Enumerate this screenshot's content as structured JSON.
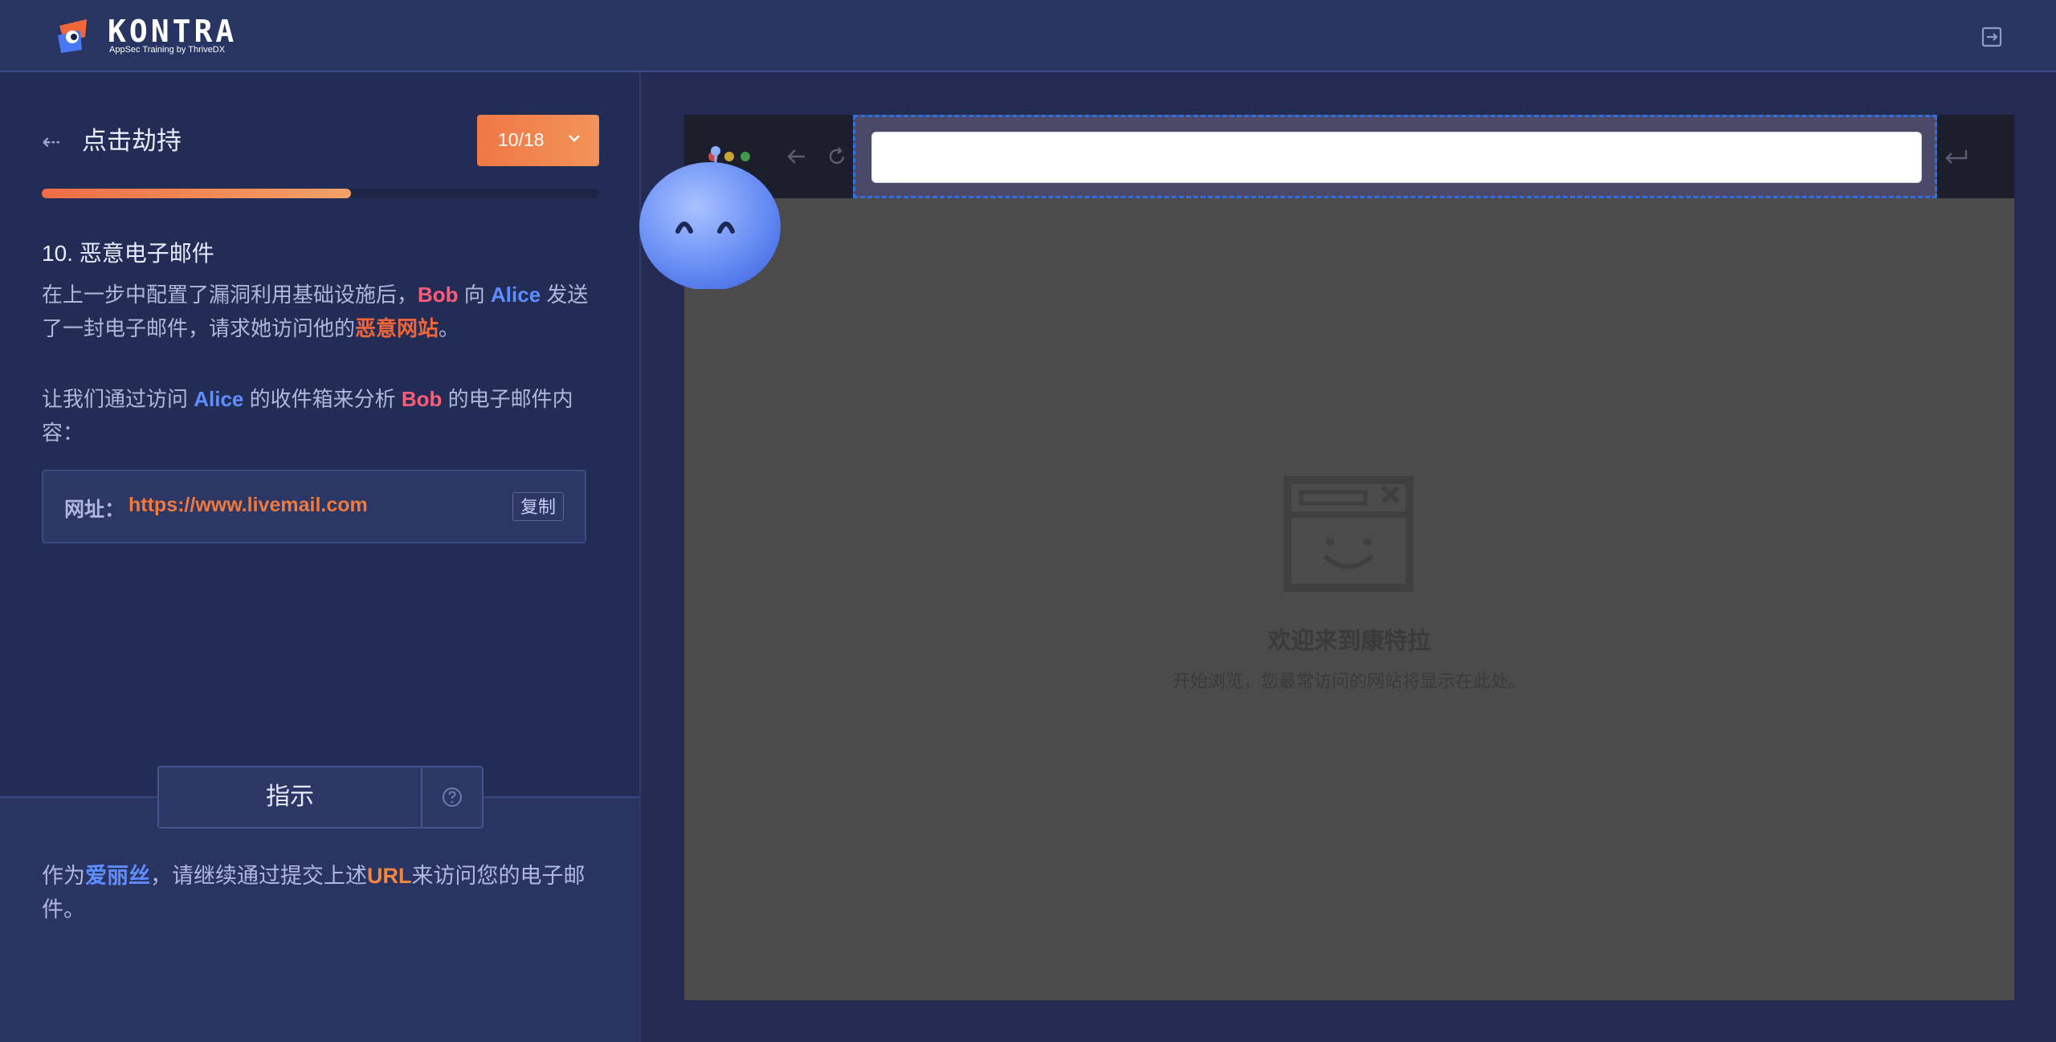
{
  "header": {
    "brand": "KONTRA",
    "tagline": "AppSec Training by ThriveDX"
  },
  "lesson": {
    "title": "点击劫持",
    "step_indicator": "10/18",
    "progress": 0.555
  },
  "step": {
    "title": "10. 恶意电子邮件",
    "p1_a": "在上一步中配置了漏洞利用基础设施后，",
    "p1_bob": "Bob",
    "p1_b": " 向 ",
    "p1_alice": "Alice",
    "p1_c": " 发送了一封电子邮件，请求她访问他的",
    "p1_site": "恶意网站",
    "p1_d": "。",
    "p2_a": "让我们通过访问 ",
    "p2_alice": "Alice",
    "p2_b": " 的收件箱来分析 ",
    "p2_bob": "Bob",
    "p2_c": " 的电子邮件内容：",
    "url_label": "网址：",
    "url_value": "https://www.livemail.com",
    "copy_label": "复制"
  },
  "instructions": {
    "tab_label": "指示",
    "text_a": "作为",
    "text_name": "爱丽丝",
    "text_b": "，请继续通过提交上述",
    "text_url": "URL",
    "text_c": "来访问您的电子邮件。"
  },
  "browser": {
    "address_value": "",
    "welcome_title": "欢迎来到康特拉",
    "welcome_sub": "开始浏览，您最常访问的网站将显示在此处。"
  },
  "colors": {
    "accent_orange": "#f07845",
    "highlight_blue": "#5e8dff",
    "highlight_red": "#ff5c7a",
    "address_outline": "#2f6fe0"
  },
  "icons": [
    "kontra-logo-icon",
    "logout-icon",
    "back-arrow-icon",
    "chevron-down-icon",
    "help-icon",
    "nav-back-icon",
    "reload-icon",
    "enter-icon",
    "empty-page-icon",
    "mascot-icon"
  ]
}
